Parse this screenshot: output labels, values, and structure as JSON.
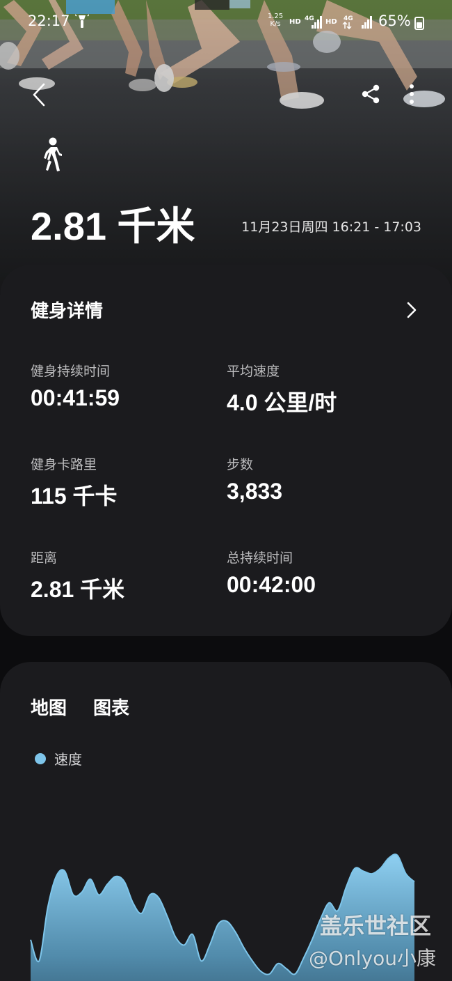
{
  "status_bar": {
    "time": "22:17",
    "net_speed_value": "1.25",
    "net_speed_unit": "K/s",
    "hd_1": "HD",
    "hd_2": "HD",
    "network_1": "4G",
    "network_2": "4G",
    "battery": "65%",
    "icons": [
      "flashlight-icon",
      "signal-icon",
      "signal-icon",
      "battery-icon"
    ]
  },
  "header": {
    "back_icon": "back-arrow-icon",
    "share_icon": "share-icon",
    "more_icon": "more-vertical-icon",
    "activity_icon": "walking-icon",
    "distance": "2.81 千米",
    "datetime": "11月23日周四 16:21 - 17:03"
  },
  "details": {
    "title": "健身详情",
    "chevron_icon": "chevron-right-icon",
    "metrics": [
      {
        "label": "健身持续时间",
        "value": "00:41:59"
      },
      {
        "label": "平均速度",
        "value": "4.0 公里/时"
      },
      {
        "label": "健身卡路里",
        "value": "115 千卡"
      },
      {
        "label": "步数",
        "value": "3,833"
      },
      {
        "label": "距离",
        "value": "2.81 千米"
      },
      {
        "label": "总持续时间",
        "value": "00:42:00"
      }
    ]
  },
  "chart_section": {
    "tabs": [
      {
        "label": "地图"
      },
      {
        "label": "图表"
      }
    ],
    "legend_label": "速度",
    "series_color": "#7ec5ea"
  },
  "chart_data": {
    "type": "area",
    "title": "",
    "xlabel": "",
    "ylabel": "",
    "grid": false,
    "legend": "top-left",
    "series": [
      {
        "name": "速度",
        "color": "#7ec5ea",
        "values": [
          3.2,
          2.4,
          4.4,
          5.6,
          5.8,
          4.9,
          5.0,
          5.5,
          4.9,
          5.3,
          5.6,
          5.4,
          4.6,
          4.2,
          4.9,
          4.8,
          4.1,
          3.3,
          3.0,
          3.4,
          2.4,
          3.0,
          3.8,
          3.9,
          3.5,
          2.9,
          2.4,
          2.0,
          1.9,
          2.3,
          2.1,
          1.9,
          2.5,
          3.2,
          4.0,
          4.6,
          4.3,
          5.2,
          5.9,
          5.8,
          5.7,
          5.9,
          6.3,
          6.4,
          5.7,
          5.4
        ]
      }
    ]
  },
  "watermark": {
    "line1": "盖乐世社区",
    "line2": "@Onlyou小康"
  }
}
